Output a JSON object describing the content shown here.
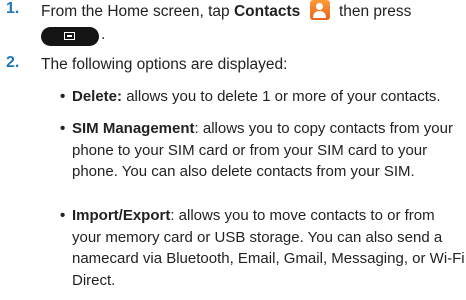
{
  "step1": {
    "number": "1.",
    "text_before": "From the Home screen, tap",
    "contacts_label": "Contacts",
    "text_after": "then press",
    "period": ".",
    "contacts_icon": "contacts-app-icon",
    "menu_key_icon": "menu-key-icon"
  },
  "step2": {
    "number": "2.",
    "text": "The following options are displayed:"
  },
  "bullets": [
    {
      "term": "Delete:",
      "desc": "allows you to delete 1 or more of your contacts."
    },
    {
      "term": "SIM Management",
      "desc": ": allows you to copy contacts from your phone to your SIM card or from your SIM card to your phone. You can also delete contacts from your SIM."
    },
    {
      "term": "Import/Export",
      "desc": ": allows you to move contacts to or from your memory card or USB storage. You can also send a namecard via Bluetooth, Email, Gmail, Messaging, or Wi-Fi Direct."
    }
  ],
  "colors": {
    "step_number": "#2178b8",
    "contacts_icon": "#f07a26",
    "menu_key": "#141414"
  }
}
